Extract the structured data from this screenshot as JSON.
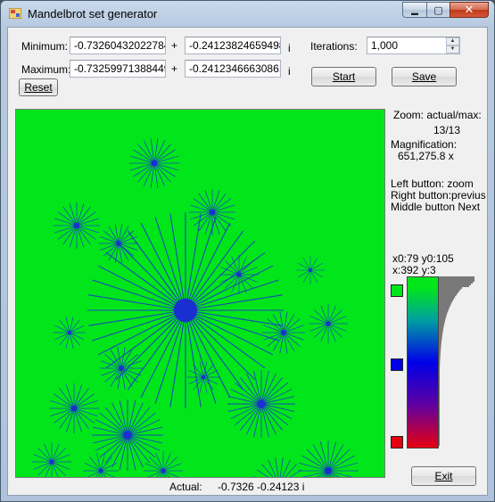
{
  "window": {
    "title": "Mandelbrot set generator",
    "min_glyph": "▬",
    "max_glyph": "▢",
    "close_glyph": "✕"
  },
  "inputs": {
    "minimum_label": "Minimum:",
    "maximum_label": "Maximum:",
    "plus": "+",
    "imag_suffix": "i",
    "min_real": "-0.73260432022784",
    "min_imag": "-0.24123824659498",
    "max_real": "-0.73259971388449",
    "max_imag": "-0.24123466630861",
    "iterations_label": "Iterations:",
    "iterations_value": "1,000"
  },
  "buttons": {
    "reset": "Reset",
    "start": "Start",
    "save": "Save",
    "exit": "Exit"
  },
  "info": {
    "zoom_label": "Zoom: actual/max:",
    "zoom_value": "13/13",
    "magnification_label": "Magnification:",
    "magnification_value": "651,275.8 x",
    "help_1": "Left button: zoom",
    "help_2": "Right button:previus",
    "help_3": "Middle button Next",
    "coords_1": "x0:79 y0:105",
    "coords_2": "x:392 y:3"
  },
  "status": {
    "actual_label": "Actual:",
    "actual_value": "-0.7326 -0.24123 i"
  },
  "colors": {
    "fractal_bg": "#00e61a",
    "fractal_blue": "#1a2fd0",
    "swatch_top": "#00e61a",
    "swatch_mid": "#0000e8",
    "swatch_bottom": "#e60010"
  }
}
